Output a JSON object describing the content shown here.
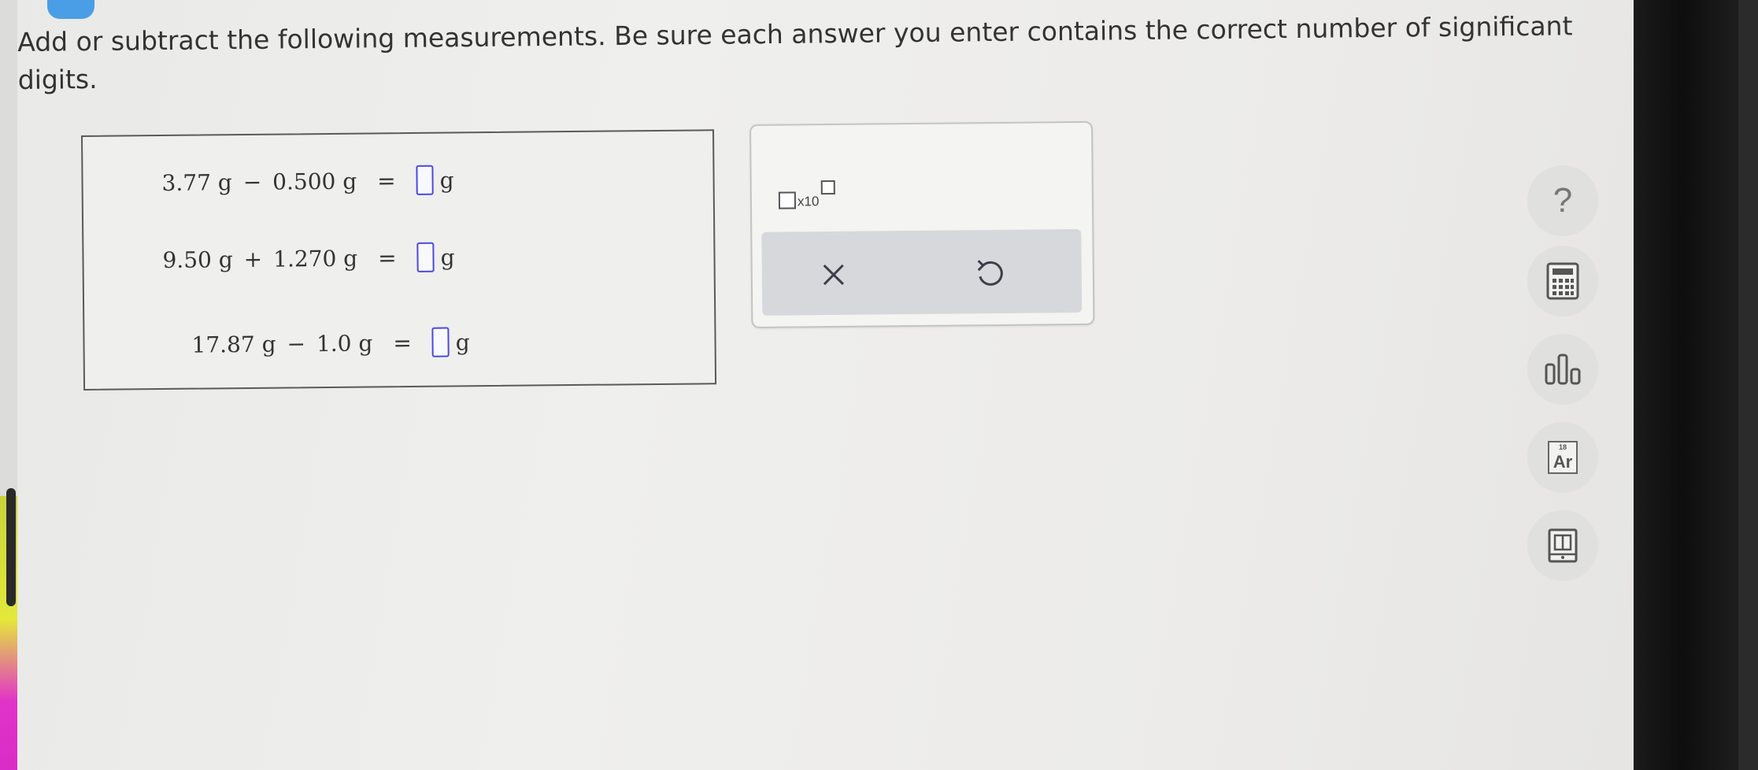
{
  "prompt": "Add or subtract the following measurements. Be sure each answer you enter contains the correct number of significant digits.",
  "equations": [
    {
      "operand1": "3.77 g",
      "operator": "−",
      "operand2": "0.500 g",
      "equals": "=",
      "unit": "g"
    },
    {
      "operand1": "9.50 g",
      "operator": "+",
      "operand2": "1.270 g",
      "equals": "=",
      "unit": "g"
    },
    {
      "operand1": "17.87 g",
      "operator": "−",
      "operand2": "1.0 g",
      "equals": "=",
      "unit": "g"
    }
  ],
  "panel": {
    "sci_label": "x10",
    "clear_symbol": "×",
    "undo_symbol": "↺"
  },
  "tools": {
    "help_label": "?",
    "periodic_number": "18",
    "periodic_symbol": "Ar"
  },
  "colors": {
    "answer_box_border": "#4a4ae0",
    "panel_bar": "#d6d8dc",
    "accent": "#4a9ee6"
  },
  "icons": [
    "help-icon",
    "calculator-icon",
    "data-chart-icon",
    "periodic-table-icon",
    "reference-book-icon",
    "clear-icon",
    "undo-icon"
  ]
}
